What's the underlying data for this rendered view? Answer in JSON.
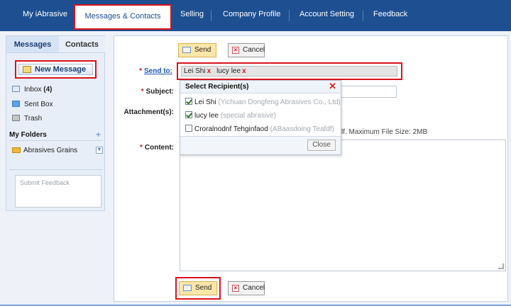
{
  "nav": {
    "items": [
      "My iAbrasive",
      "Messages & Contacts",
      "Selling",
      "Company Profile",
      "Account Setting",
      "Feedback"
    ],
    "active": "Messages & Contacts"
  },
  "sidebar": {
    "tab_messages": "Messages",
    "tab_contacts": "Contacts",
    "new_message": "New Message",
    "inbox_label": "Inbox",
    "inbox_count": "(4)",
    "sent_box": "Sent Box",
    "trash": "Trash",
    "my_folders": "My Folders",
    "add_folder": "+",
    "folder_name": "Abrasives Grains",
    "feedback_placeholder": "Submit Feedback"
  },
  "toolbar": {
    "send": "Send",
    "cancel": "Cancel"
  },
  "form": {
    "required_mark": "*",
    "send_to_label": "Send to:",
    "subject_label": "Subject:",
    "attachment_label": "Attachment(s):",
    "content_label": "Content:",
    "recipients": [
      {
        "name": "Lei Shi",
        "remove": "x"
      },
      {
        "name": "lucy lee",
        "remove": "x"
      }
    ],
    "file_info": "lf. Maximum File Size: 2MB"
  },
  "dropdown": {
    "title": "Select Recipient(s)",
    "close_mark": "✕",
    "options": [
      {
        "name": "Lei Shi",
        "company": "(Yichuan Dongfeng Abrasives Co., Ltd)",
        "checked": true
      },
      {
        "name": "lucy lee",
        "company": "(special abrasive)",
        "checked": true
      },
      {
        "name": "Croralnodnf Tehginfaod",
        "company": "(ABaasdoing Teafdf)",
        "checked": false
      }
    ],
    "close_button": "Close"
  },
  "colors": {
    "nav_bg": "#1d4f91",
    "highlight": "#d8141c",
    "send_button": "#fde6a8"
  }
}
